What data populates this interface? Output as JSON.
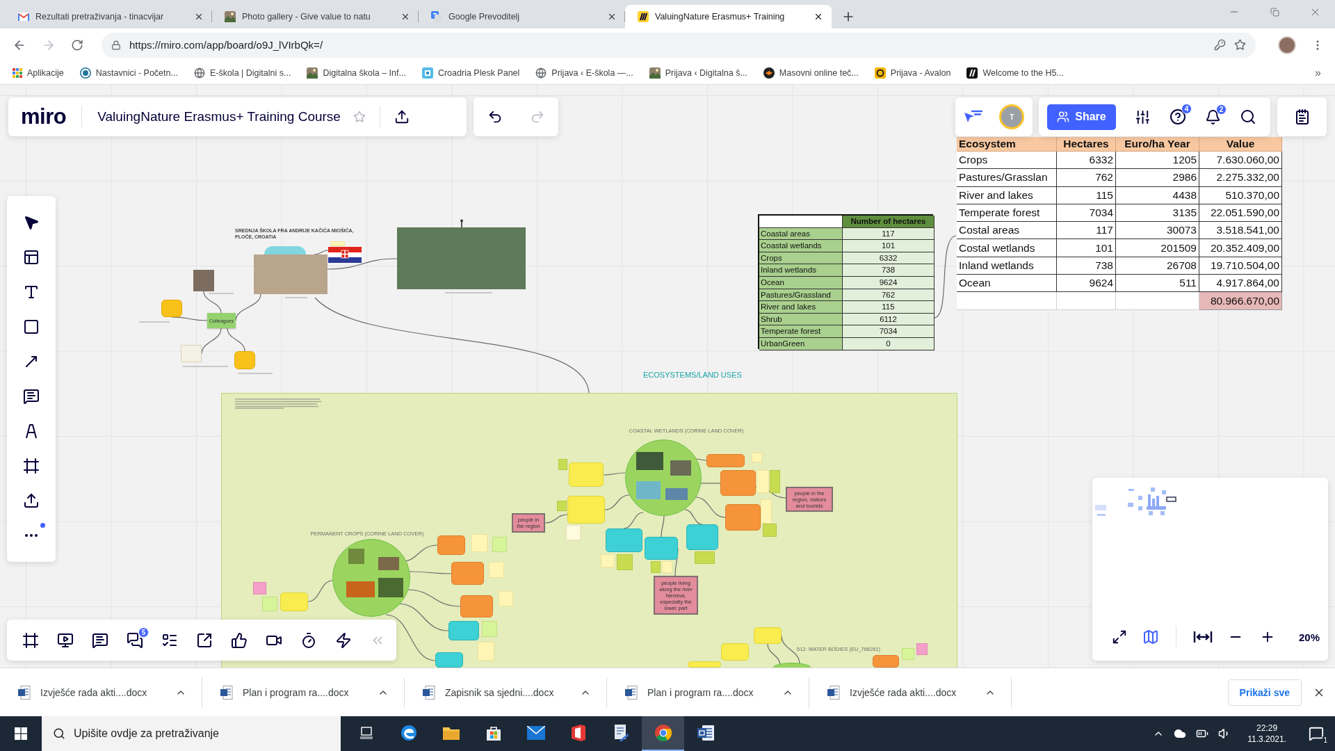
{
  "browser": {
    "tabs": [
      {
        "title": "Rezultati pretraživanja - tinacvijar",
        "kind": "mail",
        "selected": false
      },
      {
        "title": "Photo gallery - Give value to natu",
        "kind": "photo",
        "selected": false
      },
      {
        "title": "Google Prevoditelj",
        "kind": "translate",
        "selected": false
      },
      {
        "title": "ValuingNature Erasmus+ Training",
        "kind": "board",
        "selected": true
      }
    ],
    "address": "https://miro.com/app/board/o9J_lVIrbQk=/",
    "bookmarks": [
      {
        "label": "Aplikacije",
        "kind": "apps"
      },
      {
        "label": "Nastavnici - Početn...",
        "kind": "wordpress"
      },
      {
        "label": "E-škola | Digitalni s...",
        "kind": "globe"
      },
      {
        "label": "Digitalna škola – Inf...",
        "kind": "photo"
      },
      {
        "label": "Croadria Plesk Panel",
        "kind": "plesk"
      },
      {
        "label": "Prijava ‹ E-škola —...",
        "kind": "globe"
      },
      {
        "label": "Prijava ‹ Digitalna š...",
        "kind": "photo"
      },
      {
        "label": "Masovni online teč...",
        "kind": "moodle"
      },
      {
        "label": "Prijava - Avalon",
        "kind": "avalon"
      },
      {
        "label": "Welcome to the H5...",
        "kind": "hp"
      }
    ],
    "bookmarks_more": "»"
  },
  "board": {
    "logo": "miro",
    "title": "ValuingNature Erasmus+ Training Course",
    "undo_disabled": false,
    "redo_disabled": true,
    "avatar": "T",
    "share": "Share",
    "help_count": "4",
    "notification_count": "2",
    "chat_count": "5",
    "minimap_open": true,
    "zoom": "20%"
  },
  "canvas": {
    "school": {
      "title": "SREDNJA ŠKOLA FRA ANDRIJE KAČIĆA MIOŠIĆA, PLOČE, CROATIA",
      "hub": "Colleagues"
    },
    "hectares_table": {
      "header": "Number of hectares",
      "rows": [
        [
          "Coastal areas",
          "117"
        ],
        [
          "Coastal wetlands",
          "101"
        ],
        [
          "Crops",
          "6332"
        ],
        [
          "Inland wetlands",
          "738"
        ],
        [
          "Ocean",
          "9624"
        ],
        [
          "Pastures/Grassland",
          "762"
        ],
        [
          "River and lakes",
          "115"
        ],
        [
          "Shrub",
          "6112"
        ],
        [
          "Temperate forest",
          "7034"
        ],
        [
          "UrbanGreen",
          "0"
        ]
      ]
    },
    "value_table": {
      "columns": [
        "Ecosystem",
        "Hectares",
        "Euro/ha Year",
        "Value"
      ],
      "rows": [
        [
          "Crops",
          "6332",
          "1205",
          "7.630.060,00"
        ],
        [
          "Pastures/Grasslan",
          "762",
          "2986",
          "2.275.332,00"
        ],
        [
          "River and lakes",
          "115",
          "4438",
          "510.370,00"
        ],
        [
          "Temperate forest",
          "7034",
          "3135",
          "22.051.590,00"
        ],
        [
          "Costal areas",
          "117",
          "30073",
          "3.518.541,00"
        ],
        [
          "Costal wetlands",
          "101",
          "201509",
          "20.352.409,00"
        ],
        [
          "Inland wetlands",
          "738",
          "26708",
          "19.710.504,00"
        ],
        [
          "Ocean",
          "9624",
          "511",
          "4.917.864,00"
        ]
      ],
      "total": "80.966.670,00"
    },
    "frame": {
      "title": "ECOSYSTEMS/LAND USES",
      "maps": [
        "COASTAL WETLANDS (CORINE LAND COVER)",
        "PERMANENT CROPS (CORINE LAND COVER)",
        "512: WATER BODIES (EU_766261)"
      ],
      "beneficiaries": [
        "people in the region, visitors and tourists",
        "people in the region",
        "people living along the river Neretva, especially the lower part"
      ]
    }
  },
  "downloads": {
    "files": [
      "Izvješće rada akti....docx",
      "Plan i program ra....docx",
      "Zapisnik sa sjedni....docx",
      "Plan i program ra....docx",
      "Izvješće rada akti....docx"
    ],
    "show_all": "Prikaži sve"
  },
  "taskbar": {
    "search_placeholder": "Upišite ovdje za pretraživanje",
    "apps": [
      {
        "kind": "taskview",
        "selected": false
      },
      {
        "kind": "edge",
        "selected": false
      },
      {
        "kind": "explorer",
        "selected": false
      },
      {
        "kind": "store",
        "selected": false
      },
      {
        "kind": "mail",
        "selected": false
      },
      {
        "kind": "office",
        "selected": false
      },
      {
        "kind": "scanner",
        "selected": false
      },
      {
        "kind": "chrome",
        "selected": true
      },
      {
        "kind": "word",
        "selected": false
      }
    ],
    "time": "22:29",
    "date": "11.3.2021.",
    "notifications": "1"
  }
}
